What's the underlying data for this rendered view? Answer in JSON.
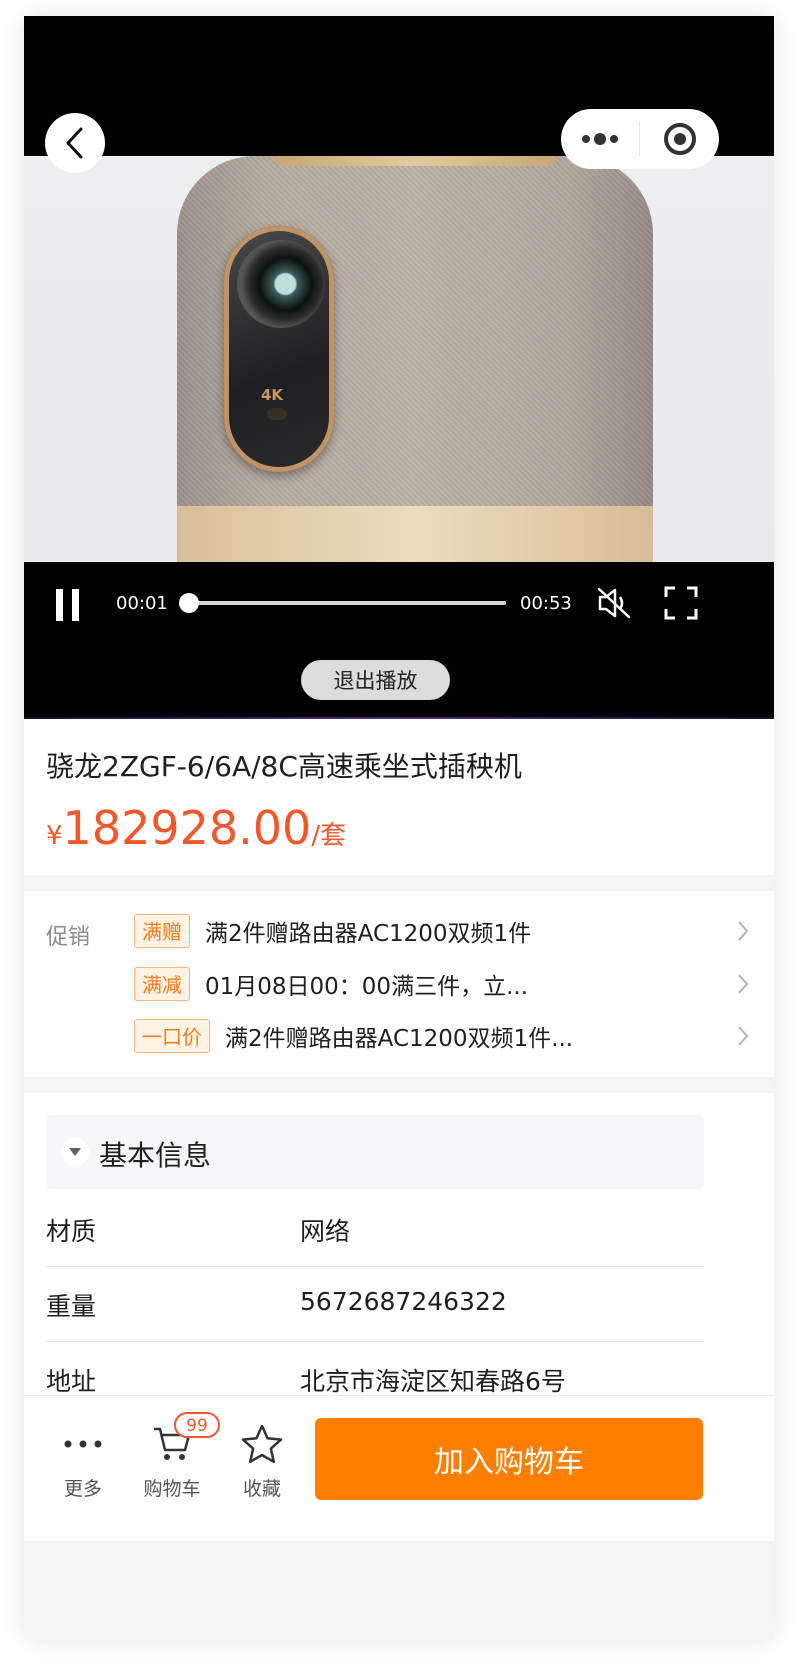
{
  "video": {
    "current_time": "00:01",
    "duration": "00:53",
    "progress": 0.02,
    "exit_label": "退出播放",
    "badge_4k": "4K"
  },
  "product": {
    "title": "骁龙2ZGF-6/6A/8C高速乘坐式插秧机",
    "currency": "¥",
    "price": "182928.00",
    "unit": "/套",
    "price_color": "#f2562b"
  },
  "promotions": {
    "label": "促销",
    "items": [
      {
        "tag": "满赠",
        "text": "满2件赠路由器AC1200双频1件"
      },
      {
        "tag": "满减",
        "text": "01月08日00：00满三件，立..."
      },
      {
        "tag": "一口价",
        "text": "满2件赠路由器AC1200双频1件..."
      }
    ]
  },
  "basic": {
    "heading": "基本信息",
    "rows": [
      {
        "key": "材质",
        "value": "网络"
      },
      {
        "key": "重量",
        "value": "5672687246322"
      },
      {
        "key": "地址",
        "value": "北京市海淀区知春路6号"
      }
    ]
  },
  "bottom_bar": {
    "more_label": "更多",
    "cart_label": "购物车",
    "cart_count": "99",
    "fav_label": "收藏",
    "add_to_cart": "加入购物车",
    "accent": "#ff7e00"
  },
  "icons": [
    "back-icon",
    "more-dots-icon",
    "target-icon",
    "pause-icon",
    "mute-icon",
    "fullscreen-icon",
    "chevron-right-icon",
    "caret-down-icon",
    "cart-icon",
    "star-icon"
  ]
}
